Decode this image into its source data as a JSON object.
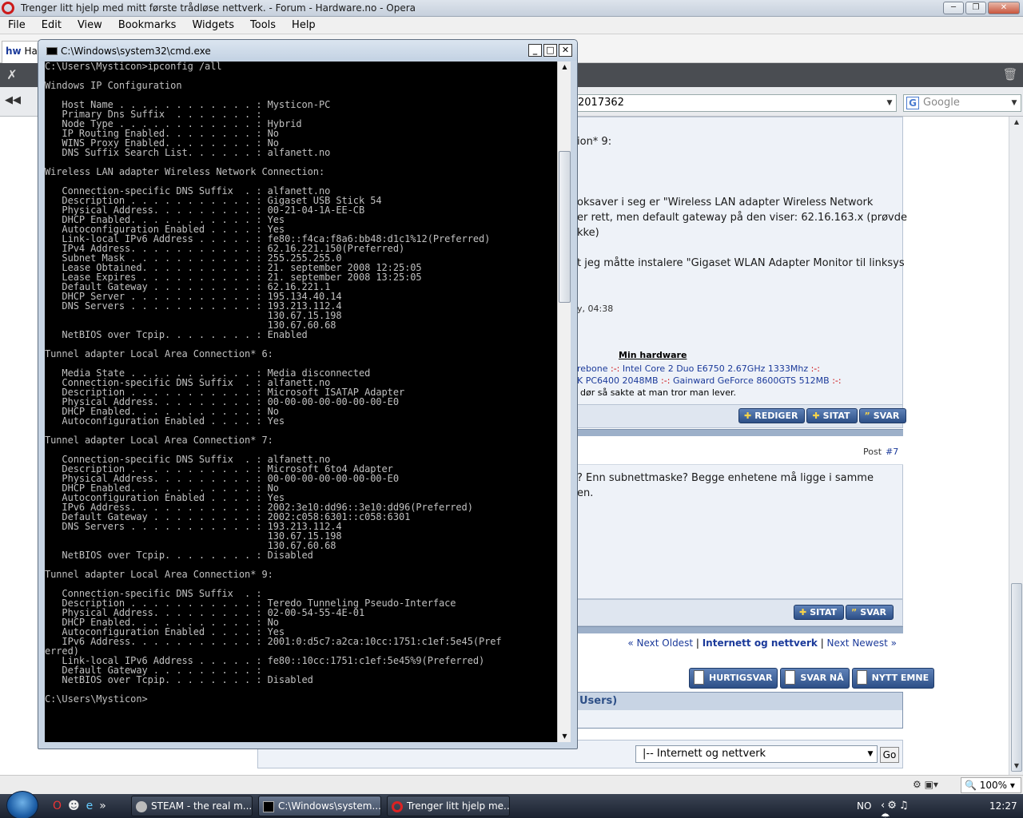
{
  "opera": {
    "title": "Trenger litt hjelp med mitt første trådløse nettverk. - Forum - Hardware.no - Opera",
    "menu": [
      "File",
      "Edit",
      "View",
      "Bookmarks",
      "Widgets",
      "Tools",
      "Help"
    ],
    "tab_label": "Hard",
    "address_visible": "2017362",
    "search_placeholder": "Google",
    "zoom": "100%"
  },
  "forum": {
    "post1_lines": [
      "ion* 9:",
      "oksaver i seg er \"Wireless LAN adapter Wireless Network",
      "er rett, men default gateway på den viser: 62.16.163.x (prøvde",
      "kke)",
      "t jeg måtte instalere \"Gigaset WLAN Adapter Monitor til linksys"
    ],
    "post1_time": "y, 04:38",
    "hardware_heading": "Min hardware",
    "hw_line1_a": "rebone",
    "hw_line1_b": "Intel Core 2 Duo E6750 2.67GHz 1333Mhz",
    "hw_line2_a": "K PC6400 2048MB",
    "hw_line2_b": "Gainward GeForce 8600GTS 512MB",
    "hw_sep": ":-:",
    "signature": "dør så sakte at man tror man lever.",
    "btn_edit": "REDIGER",
    "btn_quote": "SITAT",
    "btn_reply": "SVAR",
    "post_label": "Post",
    "post_number": "#7",
    "post2_lines": [
      "? Enn subnettmaske? Begge enhetene må ligge i samme",
      "en."
    ],
    "thread_nav_prev": "« Next Oldest",
    "thread_nav_forum": "Internett og nettverk",
    "thread_nav_next": "Next Newest »",
    "btn_quickreply": "HURTIGSVAR",
    "btn_replynow": "SVAR NÅ",
    "btn_newtopic": "NYTT EMNE",
    "users_header": "Users)",
    "jump_selected": "|-- Internett og nettverk",
    "go_label": "Go"
  },
  "cmd": {
    "title": "C:\\Windows\\system32\\cmd.exe",
    "output": "C:\\Users\\Mysticon>ipconfig /all\n\nWindows IP Configuration\n\n   Host Name . . . . . . . . . . . . : Mysticon-PC\n   Primary Dns Suffix  . . . . . . . :\n   Node Type . . . . . . . . . . . . : Hybrid\n   IP Routing Enabled. . . . . . . . : No\n   WINS Proxy Enabled. . . . . . . . : No\n   DNS Suffix Search List. . . . . . : alfanett.no\n\nWireless LAN adapter Wireless Network Connection:\n\n   Connection-specific DNS Suffix  . : alfanett.no\n   Description . . . . . . . . . . . : Gigaset USB Stick 54\n   Physical Address. . . . . . . . . : 00-21-04-1A-EE-CB\n   DHCP Enabled. . . . . . . . . . . : Yes\n   Autoconfiguration Enabled . . . . : Yes\n   Link-local IPv6 Address . . . . . : fe80::f4ca:f8a6:bb48:d1c1%12(Preferred)\n   IPv4 Address. . . . . . . . . . . : 62.16.221.150(Preferred)\n   Subnet Mask . . . . . . . . . . . : 255.255.255.0\n   Lease Obtained. . . . . . . . . . : 21. september 2008 12:25:05\n   Lease Expires . . . . . . . . . . : 21. september 2008 13:25:05\n   Default Gateway . . . . . . . . . : 62.16.221.1\n   DHCP Server . . . . . . . . . . . : 195.134.40.14\n   DNS Servers . . . . . . . . . . . : 193.213.112.4\n                                       130.67.15.198\n                                       130.67.60.68\n   NetBIOS over Tcpip. . . . . . . . : Enabled\n\nTunnel adapter Local Area Connection* 6:\n\n   Media State . . . . . . . . . . . : Media disconnected\n   Connection-specific DNS Suffix  . : alfanett.no\n   Description . . . . . . . . . . . : Microsoft ISATAP Adapter\n   Physical Address. . . . . . . . . : 00-00-00-00-00-00-00-E0\n   DHCP Enabled. . . . . . . . . . . : No\n   Autoconfiguration Enabled . . . . : Yes\n\nTunnel adapter Local Area Connection* 7:\n\n   Connection-specific DNS Suffix  . : alfanett.no\n   Description . . . . . . . . . . . : Microsoft 6to4 Adapter\n   Physical Address. . . . . . . . . : 00-00-00-00-00-00-00-E0\n   DHCP Enabled. . . . . . . . . . . : No\n   Autoconfiguration Enabled . . . . : Yes\n   IPv6 Address. . . . . . . . . . . : 2002:3e10:dd96::3e10:dd96(Preferred)\n   Default Gateway . . . . . . . . . : 2002:c058:6301::c058:6301\n   DNS Servers . . . . . . . . . . . : 193.213.112.4\n                                       130.67.15.198\n                                       130.67.60.68\n   NetBIOS over Tcpip. . . . . . . . : Disabled\n\nTunnel adapter Local Area Connection* 9:\n\n   Connection-specific DNS Suffix  . :\n   Description . . . . . . . . . . . : Teredo Tunneling Pseudo-Interface\n   Physical Address. . . . . . . . . : 02-00-54-55-4E-01\n   DHCP Enabled. . . . . . . . . . . : No\n   Autoconfiguration Enabled . . . . : Yes\n   IPv6 Address. . . . . . . . . . . : 2001:0:d5c7:a2ca:10cc:1751:c1ef:5e45(Pref\nerred)\n   Link-local IPv6 Address . . . . . : fe80::10cc:1751:c1ef:5e45%9(Preferred)\n   Default Gateway . . . . . . . . . :\n   NetBIOS over Tcpip. . . . . . . . : Disabled\n\nC:\\Users\\Mysticon>"
  },
  "taskbar": {
    "buttons": [
      "STEAM - the real m...",
      "C:\\Windows\\system...",
      "Trenger litt hjelp me..."
    ],
    "language": "NO",
    "clock": "12:27"
  },
  "colors": {
    "forum_blue": "#2d4f87",
    "link": "#1b3a9a",
    "console_text": "#c0c0c0"
  }
}
